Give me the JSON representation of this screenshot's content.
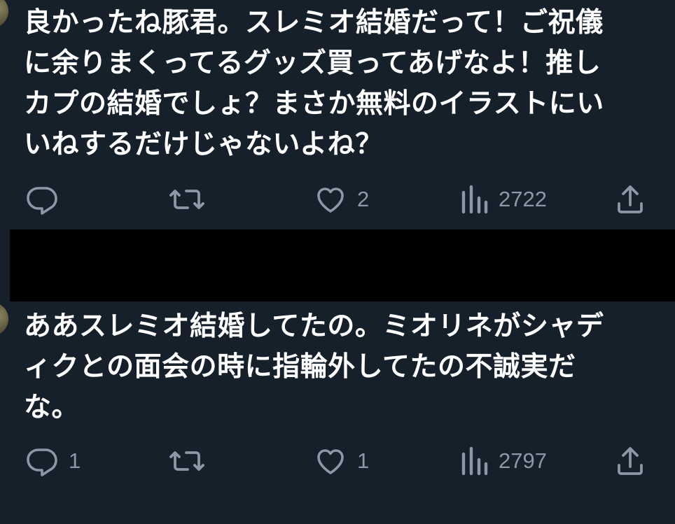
{
  "tweets": [
    {
      "text": "良かったね豚君。スレミオ結婚だって！ご祝儀\nに余りまくってるグッズ買ってあげなよ！推し\nカプの結婚でしょ？まさか無料のイラストにい\nいねするだけじゃないよね？",
      "actions": {
        "reply_count": "",
        "retweet_count": "",
        "like_count": "2",
        "view_count": "2722"
      }
    },
    {
      "text": "ああスレミオ結婚してたの。ミオリネがシャデ\nィクとの面会の時に指輪外してたの不誠実だ\nな。",
      "actions": {
        "reply_count": "1",
        "retweet_count": "",
        "like_count": "1",
        "view_count": "2797"
      }
    }
  ],
  "icons": {
    "reply": "reply-icon",
    "retweet": "retweet-icon",
    "like": "heart-icon",
    "views": "views-icon",
    "share": "share-icon"
  },
  "colors": {
    "background": "#15202b",
    "text": "#ffffff",
    "muted": "#8b98a5",
    "redaction": "#000000"
  }
}
